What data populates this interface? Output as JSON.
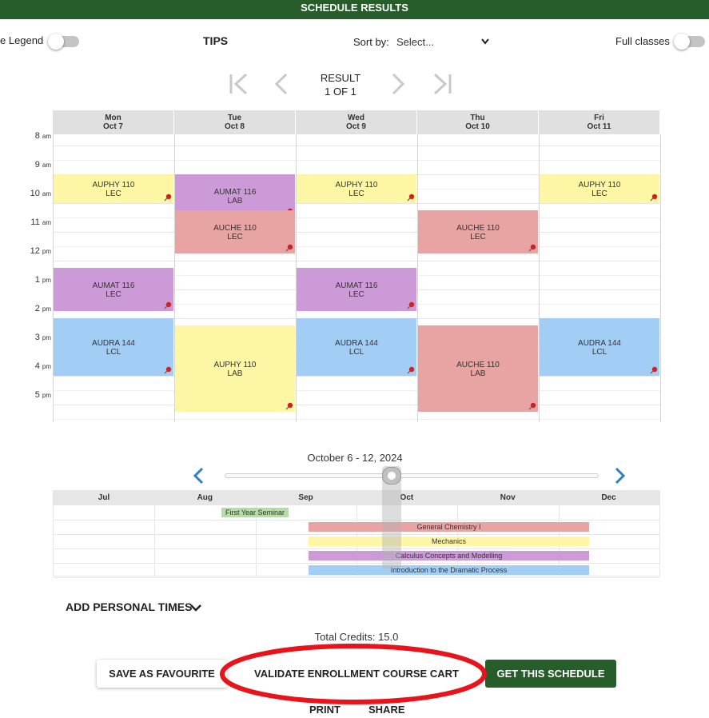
{
  "header": {
    "title": "SCHEDULE RESULTS"
  },
  "toolbar": {
    "legend_label": "e Legend",
    "tips_label": "TIPS",
    "sort_label": "Sort by:",
    "sort_value": "Select...",
    "full_classes_label": "Full classes"
  },
  "pager": {
    "result_label": "RESULT",
    "result_count": "1 OF 1"
  },
  "calendar": {
    "days": [
      {
        "name": "Mon",
        "date": "Oct 7"
      },
      {
        "name": "Tue",
        "date": "Oct 8"
      },
      {
        "name": "Wed",
        "date": "Oct 9"
      },
      {
        "name": "Thu",
        "date": "Oct 10"
      },
      {
        "name": "Fri",
        "date": "Oct 11"
      }
    ],
    "times": [
      {
        "num": "8",
        "ampm": "am"
      },
      {
        "num": "9",
        "ampm": "am"
      },
      {
        "num": "10",
        "ampm": "am"
      },
      {
        "num": "11",
        "ampm": "am"
      },
      {
        "num": "12",
        "ampm": "pm"
      },
      {
        "num": "1",
        "ampm": "pm"
      },
      {
        "num": "2",
        "ampm": "pm"
      },
      {
        "num": "3",
        "ampm": "pm"
      },
      {
        "num": "4",
        "ampm": "pm"
      },
      {
        "num": "5",
        "ampm": "pm"
      }
    ],
    "events": [
      {
        "course": "AUPHY 110",
        "type": "LEC",
        "day": "Mon",
        "start": "9:00",
        "end": "10:00",
        "color": "#fdf6a4"
      },
      {
        "course": "AUMAT 116",
        "type": "LEC",
        "day": "Mon",
        "start": "12:15",
        "end": "13:45",
        "color": "#cd9ad8"
      },
      {
        "course": "AUDRA 144",
        "type": "LCL",
        "day": "Mon",
        "start": "14:00",
        "end": "16:00",
        "color": "#a2cdf4"
      },
      {
        "course": "AUMAT 116",
        "type": "LAB",
        "day": "Tue",
        "start": "9:00",
        "end": "10:30",
        "color": "#cd9ad8"
      },
      {
        "course": "AUCHE 110",
        "type": "LEC",
        "day": "Tue",
        "start": "10:15",
        "end": "11:45",
        "color": "#e8a3a3"
      },
      {
        "course": "AUPHY 110",
        "type": "LAB",
        "day": "Tue",
        "start": "14:15",
        "end": "17:15",
        "color": "#fdf6a4"
      },
      {
        "course": "AUPHY 110",
        "type": "LEC",
        "day": "Wed",
        "start": "9:00",
        "end": "10:00",
        "color": "#fdf6a4"
      },
      {
        "course": "AUMAT 116",
        "type": "LEC",
        "day": "Wed",
        "start": "12:15",
        "end": "13:45",
        "color": "#cd9ad8"
      },
      {
        "course": "AUDRA 144",
        "type": "LCL",
        "day": "Wed",
        "start": "14:00",
        "end": "16:00",
        "color": "#a2cdf4"
      },
      {
        "course": "AUCHE 110",
        "type": "LEC",
        "day": "Thu",
        "start": "10:15",
        "end": "11:45",
        "color": "#e8a3a3"
      },
      {
        "course": "AUCHE 110",
        "type": "LAB",
        "day": "Thu",
        "start": "14:15",
        "end": "17:15",
        "color": "#e8a3a3"
      },
      {
        "course": "AUPHY 110",
        "type": "LEC",
        "day": "Fri",
        "start": "9:00",
        "end": "10:00",
        "color": "#fdf6a4"
      },
      {
        "course": "AUDRA 144",
        "type": "LCL",
        "day": "Fri",
        "start": "14:00",
        "end": "16:00",
        "color": "#a2cdf4"
      }
    ]
  },
  "week_range": "October 6 - 12, 2024",
  "timeline": {
    "months": [
      "Jul",
      "Aug",
      "Sep",
      "Oct",
      "Nov",
      "Dec"
    ],
    "bars": [
      "First Year Seminar",
      "General Chemistry I",
      "Mechanics",
      "Calculus Concepts and Modelling",
      "Introduction to the Dramatic Process"
    ]
  },
  "personal_times_label": "ADD PERSONAL TIMES",
  "total_credits": "Total Credits: 15.0",
  "buttons": {
    "save_favourite": "SAVE AS FAVOURITE",
    "validate_cart": "VALIDATE ENROLLMENT COURSE CART",
    "get_schedule": "GET THIS SCHEDULE",
    "print": "PRINT",
    "share": "SHARE"
  },
  "colors": {
    "header_green": "#275d2b",
    "primary_button": "#275d2b",
    "chevron_blue": "#2f7fc1",
    "annotation_red": "#e8141b"
  }
}
